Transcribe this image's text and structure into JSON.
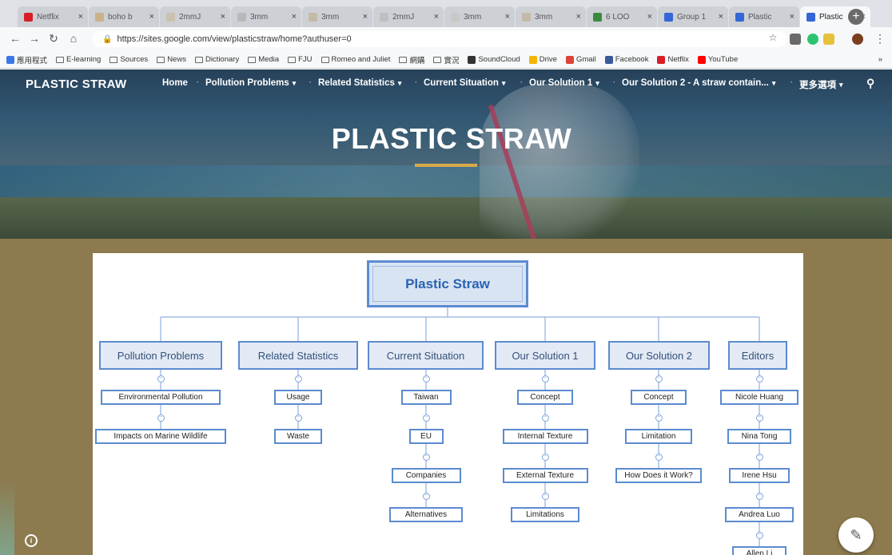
{
  "browser": {
    "tabs": [
      {
        "title": "Netflix",
        "icon": "netflix-icon",
        "color": "#d81f26"
      },
      {
        "title": "boho b",
        "icon": "page-icon",
        "color": "#c9b28a"
      },
      {
        "title": "2mmJ",
        "icon": "page-icon",
        "color": "#c9c2b0"
      },
      {
        "title": "3mm",
        "icon": "page-icon",
        "color": "#b9b9b9"
      },
      {
        "title": "3mm",
        "icon": "page-icon",
        "color": "#c4bba6"
      },
      {
        "title": "2mmJ",
        "icon": "page-icon",
        "color": "#c0c0c0"
      },
      {
        "title": "3mm",
        "icon": "page-icon",
        "color": "#c8c8c8"
      },
      {
        "title": "3mm",
        "icon": "page-icon",
        "color": "#c3bba9"
      },
      {
        "title": "6 LOO",
        "icon": "drive-icon",
        "color": "#3b8b3e"
      },
      {
        "title": "Group 1",
        "icon": "sites-icon",
        "color": "#3367d6"
      },
      {
        "title": "Plastic",
        "icon": "sites-icon",
        "color": "#3367d6"
      },
      {
        "title": "Plastic",
        "icon": "sites-icon",
        "color": "#3367d6"
      }
    ],
    "active_tab_index": 11,
    "url": "https://sites.google.com/view/plasticstraw/home?authuser=0",
    "bookmarks": [
      {
        "label": "應用程式",
        "icon": "apps-icon"
      },
      {
        "label": "E-learning",
        "icon": "folder-icon"
      },
      {
        "label": "Sources",
        "icon": "folder-icon"
      },
      {
        "label": "News",
        "icon": "folder-icon"
      },
      {
        "label": "Dictionary",
        "icon": "folder-icon"
      },
      {
        "label": "Media",
        "icon": "folder-icon"
      },
      {
        "label": "FJU",
        "icon": "folder-icon"
      },
      {
        "label": "Romeo and Juliet",
        "icon": "folder-icon"
      },
      {
        "label": "網購",
        "icon": "folder-icon"
      },
      {
        "label": "實況",
        "icon": "folder-icon"
      },
      {
        "label": "SoundCloud",
        "icon": "soundcloud-icon"
      },
      {
        "label": "Drive",
        "icon": "drive-icon"
      },
      {
        "label": "Gmail",
        "icon": "gmail-icon"
      },
      {
        "label": "Facebook",
        "icon": "facebook-icon"
      },
      {
        "label": "Netflix",
        "icon": "netflix-icon"
      },
      {
        "label": "YouTube",
        "icon": "youtube-icon"
      }
    ],
    "overflow_label": "»"
  },
  "site": {
    "title": "PLASTIC STRAW",
    "hero_title": "PLASTIC STRAW",
    "accent": "#d7a94b",
    "nav": [
      {
        "label": "Home",
        "dropdown": false
      },
      {
        "label": "Pollution Problems",
        "dropdown": true
      },
      {
        "label": "Related Statistics",
        "dropdown": true
      },
      {
        "label": "Current Situation",
        "dropdown": true
      },
      {
        "label": "Our Solution 1",
        "dropdown": true
      },
      {
        "label": "Our Solution 2 - A straw contain...",
        "dropdown": true
      },
      {
        "label": "更多選項",
        "dropdown": true
      }
    ]
  },
  "mindmap": {
    "root": "Plastic Straw",
    "categories": [
      {
        "label": "Pollution Problems",
        "children": [
          "Environmental Pollution",
          "Impacts on Marine Wildlife"
        ]
      },
      {
        "label": "Related Statistics",
        "children": [
          "Usage",
          "Waste"
        ]
      },
      {
        "label": "Current Situation",
        "children": [
          "Taiwan",
          "EU",
          "Companies",
          "Alternatives"
        ]
      },
      {
        "label": "Our Solution 1",
        "children": [
          "Concept",
          "Internal Texture",
          "External Texture",
          "Limitations"
        ]
      },
      {
        "label": "Our Solution 2",
        "children": [
          "Concept",
          "Limitation",
          "How Does it Work?"
        ]
      },
      {
        "label": "Editors",
        "children": [
          "Nicole Huang",
          "Nina Tong",
          "Irene Hsu",
          "Andrea Luo",
          "Allen Li"
        ]
      }
    ],
    "collapse_glyph": "−"
  },
  "colors": {
    "page_bg": "#8d7a4e",
    "node_border": "#5c8bd0",
    "root_text": "#2a63b1"
  },
  "fab": {
    "icon": "pencil-icon",
    "glyph": "✎"
  },
  "info": {
    "icon": "info-icon",
    "glyph": "i"
  }
}
